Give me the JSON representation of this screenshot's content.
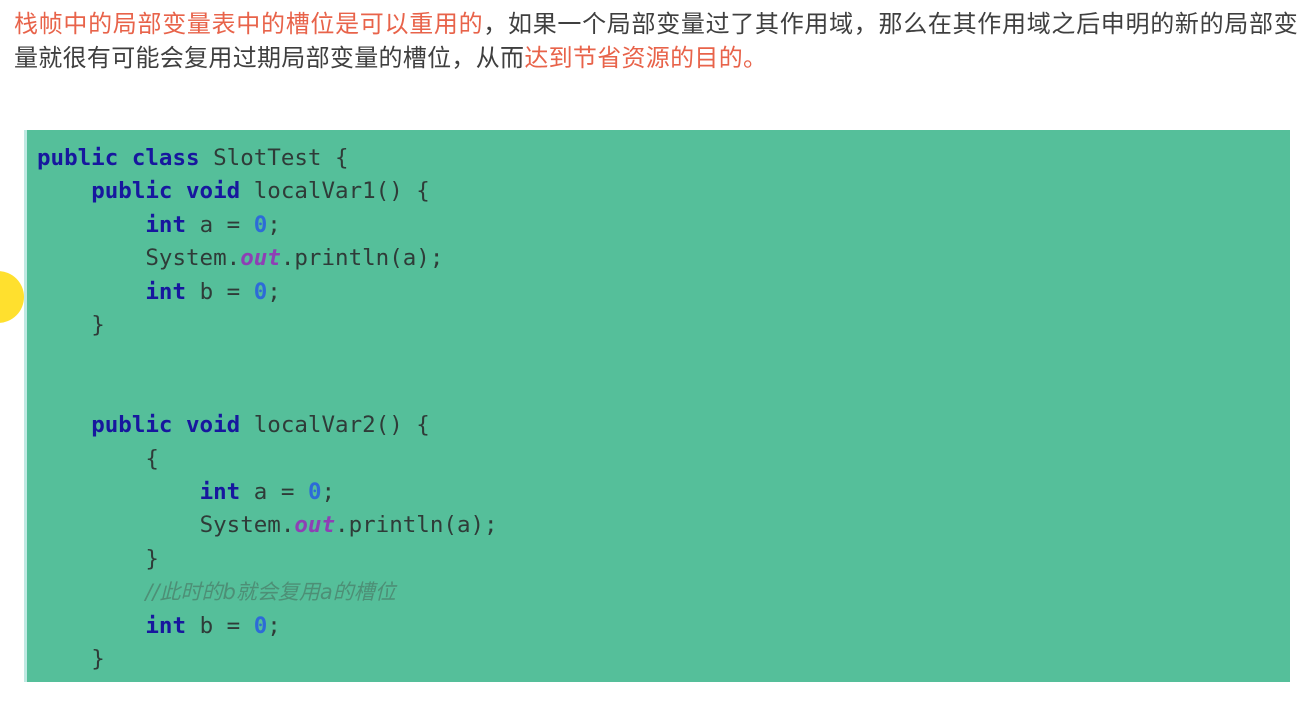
{
  "prose": {
    "segments": [
      {
        "text": "栈帧中的局部变量表中的槽位是可以重用的",
        "color": "red"
      },
      {
        "text": "，如果一个局部变量过了其作用域，那么在其作用域之后申明的新的局部变量就很有可能会复用过期局部变量的槽位，从而",
        "color": "grey"
      },
      {
        "text": "达到节省资源的目的。",
        "color": "red"
      }
    ],
    "full_text": "栈帧中的局部变量表中的槽位是可以重用的，如果一个局部变量过了其作用域，那么在其作用域之后申明的新的局部变量就很有可能会复用过期局部变量的槽位，从而达到节省资源的目的。"
  },
  "colors": {
    "prose_red": "#e8634a",
    "prose_grey": "#3f3f3f",
    "code_background": "#55bf9a",
    "code_border": "#bfe9e2",
    "bullet_yellow": "#ffe02e",
    "keyword": "#17179e",
    "number": "#2d6bd8",
    "field": "#8e3fb5",
    "comment": "#4d8f76",
    "plain": "#2f3b38"
  },
  "bullet": {
    "name": "yellow-bullet-dot"
  },
  "code": {
    "language": "java",
    "class_name": "SlotTest",
    "lines": [
      {
        "indent": 0,
        "tokens": [
          {
            "t": "public ",
            "c": "kw"
          },
          {
            "t": "class ",
            "c": "kw"
          },
          {
            "t": "SlotTest {",
            "c": "pl"
          }
        ]
      },
      {
        "indent": 1,
        "tokens": [
          {
            "t": "public ",
            "c": "kw"
          },
          {
            "t": "void ",
            "c": "kw"
          },
          {
            "t": "localVar1() {",
            "c": "pl"
          }
        ]
      },
      {
        "indent": 2,
        "tokens": [
          {
            "t": "int ",
            "c": "kw"
          },
          {
            "t": "a = ",
            "c": "pl"
          },
          {
            "t": "0",
            "c": "num"
          },
          {
            "t": ";",
            "c": "pl"
          }
        ]
      },
      {
        "indent": 2,
        "tokens": [
          {
            "t": "System.",
            "c": "pl"
          },
          {
            "t": "out",
            "c": "fld"
          },
          {
            "t": ".println(a);",
            "c": "pl"
          }
        ]
      },
      {
        "indent": 2,
        "tokens": [
          {
            "t": "int ",
            "c": "kw"
          },
          {
            "t": "b = ",
            "c": "pl"
          },
          {
            "t": "0",
            "c": "num"
          },
          {
            "t": ";",
            "c": "pl"
          }
        ]
      },
      {
        "indent": 1,
        "tokens": [
          {
            "t": "}",
            "c": "pl"
          }
        ]
      },
      {
        "indent": 0,
        "tokens": []
      },
      {
        "indent": 0,
        "tokens": []
      },
      {
        "indent": 1,
        "tokens": [
          {
            "t": "public ",
            "c": "kw"
          },
          {
            "t": "void ",
            "c": "kw"
          },
          {
            "t": "localVar2() {",
            "c": "pl"
          }
        ]
      },
      {
        "indent": 2,
        "tokens": [
          {
            "t": "{",
            "c": "pl"
          }
        ]
      },
      {
        "indent": 3,
        "tokens": [
          {
            "t": "int ",
            "c": "kw"
          },
          {
            "t": "a = ",
            "c": "pl"
          },
          {
            "t": "0",
            "c": "num"
          },
          {
            "t": ";",
            "c": "pl"
          }
        ]
      },
      {
        "indent": 3,
        "tokens": [
          {
            "t": "System.",
            "c": "pl"
          },
          {
            "t": "out",
            "c": "fld"
          },
          {
            "t": ".println(a);",
            "c": "pl"
          }
        ]
      },
      {
        "indent": 2,
        "tokens": [
          {
            "t": "}",
            "c": "pl"
          }
        ]
      },
      {
        "indent": 2,
        "tokens": [
          {
            "t": "//此时的b就会复用a的槽位",
            "c": "cmt"
          }
        ]
      },
      {
        "indent": 2,
        "tokens": [
          {
            "t": "int ",
            "c": "kw"
          },
          {
            "t": "b = ",
            "c": "pl"
          },
          {
            "t": "0",
            "c": "num"
          },
          {
            "t": ";",
            "c": "pl"
          }
        ]
      },
      {
        "indent": 1,
        "tokens": [
          {
            "t": "}",
            "c": "pl"
          }
        ]
      },
      {
        "indent": 0,
        "tokens": [
          {
            "t": "}",
            "c": "pl"
          }
        ]
      }
    ]
  },
  "watermark": {
    "text": ""
  }
}
